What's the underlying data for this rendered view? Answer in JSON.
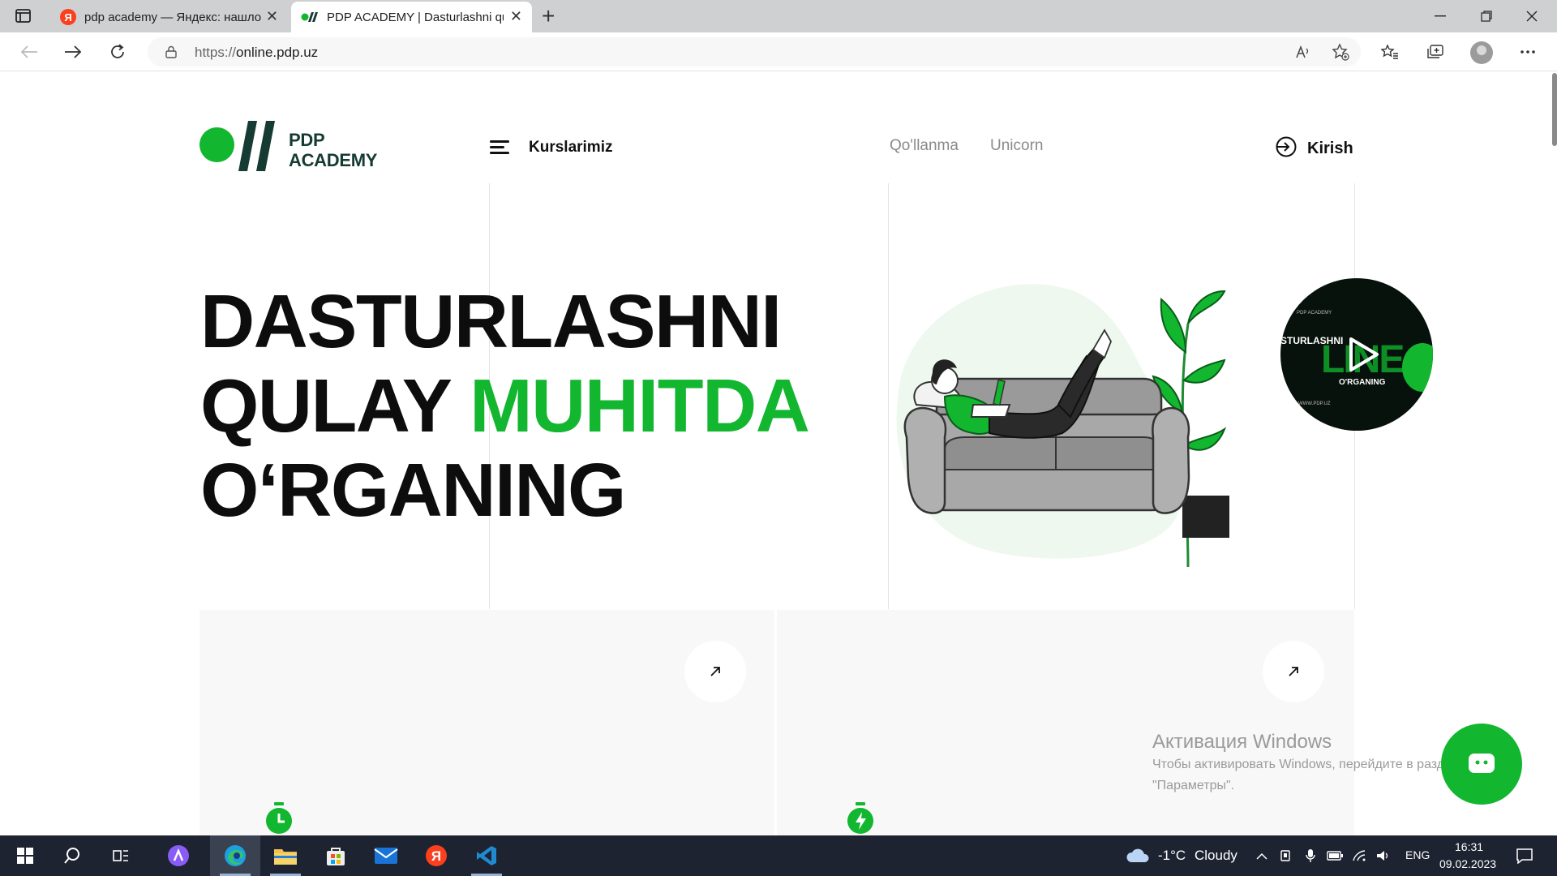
{
  "browser": {
    "tabs": [
      {
        "label": "pdp academy — Яндекс: нашлось",
        "favicon": "yandex-icon",
        "favicon_text": "Я",
        "active": false
      },
      {
        "label": "PDP ACADEMY | Dasturlashni qulay",
        "favicon": "pdp-icon",
        "active": true
      }
    ],
    "new_tab": "+",
    "close_glyph": "✕",
    "url_protocol": "https://",
    "url_host": "online.pdp.uz"
  },
  "site": {
    "logo_line1": "PDP",
    "logo_line2": "ACADEMY",
    "menu_label": "Kurslarimiz",
    "links": [
      "Qo'llanma",
      "Unicorn"
    ],
    "login_label": "Kirish",
    "hero": {
      "line1": "DASTURLASHNI",
      "line2a": "QULAY ",
      "line2b": "MUHITDA",
      "line3": "O‘RGANING"
    },
    "video": {
      "label_top": "PDP ACADEMY",
      "label_left": "STURLASHNI",
      "label_big": "LINE",
      "label_sub": "O'RGANING",
      "label_bottom": "WWW.PDP.UZ"
    },
    "colors": {
      "accent": "#12b62f",
      "logo_text": "#163b32"
    }
  },
  "watermark": {
    "title": "Активация Windows",
    "line1": "Чтобы активировать Windows, перейдите в раздел",
    "line2": "\"Параметры\"."
  },
  "taskbar": {
    "weather_temp": "-1°C",
    "weather_desc": "Cloudy",
    "language": "ENG",
    "time": "16:31",
    "date": "09.02.2023",
    "yandex_glyph": "Я"
  }
}
